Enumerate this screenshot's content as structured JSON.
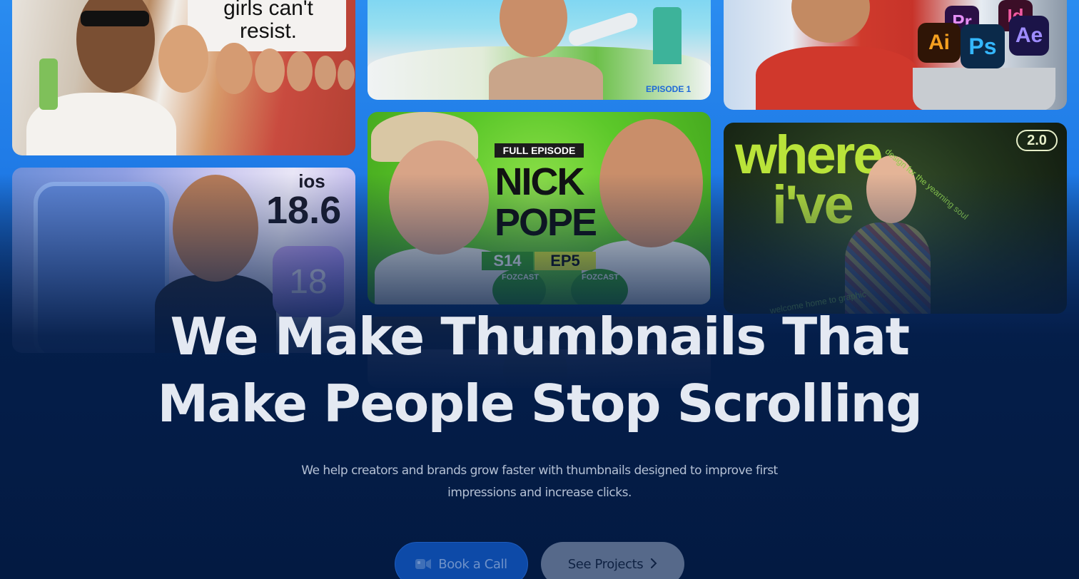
{
  "thumbnails": {
    "perfume": {
      "text": "girls can't\nresist."
    },
    "travel": {
      "badge": "EPISODE 1"
    },
    "adobe": {
      "apps": [
        "Pr",
        "Id",
        "Ai",
        "Ps",
        "Ae"
      ]
    },
    "ios": {
      "label": "ios",
      "version": "18.6",
      "icon_number": "18"
    },
    "podcast": {
      "tag": "FULL EPISODE",
      "name_line1": "NICK",
      "name_line2": "POPE",
      "season": "S14",
      "episode": "EP5",
      "brand_left": "FOZCAST",
      "brand_right": "FOZCAST"
    },
    "designer": {
      "badge": "2.0",
      "headline_line1": "where",
      "headline_line2": "i've",
      "curved_text": "design for the yearning soul",
      "curved_text_2": "welcome home to graphic"
    }
  },
  "hero": {
    "title_line1": "We Make Thumbnails That",
    "title_line2": "Make People Stop Scrolling",
    "subtitle_line1": "We help creators and brands grow faster with thumbnails designed to improve first",
    "subtitle_line2": "impressions and increase clicks."
  },
  "buttons": {
    "book_call": "Book a Call",
    "see_projects": "See Projects"
  },
  "icons": {
    "book_call": "video-camera-icon",
    "see_projects": "chevron-right-icon"
  },
  "colors": {
    "accent_blue": "#2a8cf0",
    "navy": "#041d48",
    "podcast_green": "#5cc82a"
  }
}
